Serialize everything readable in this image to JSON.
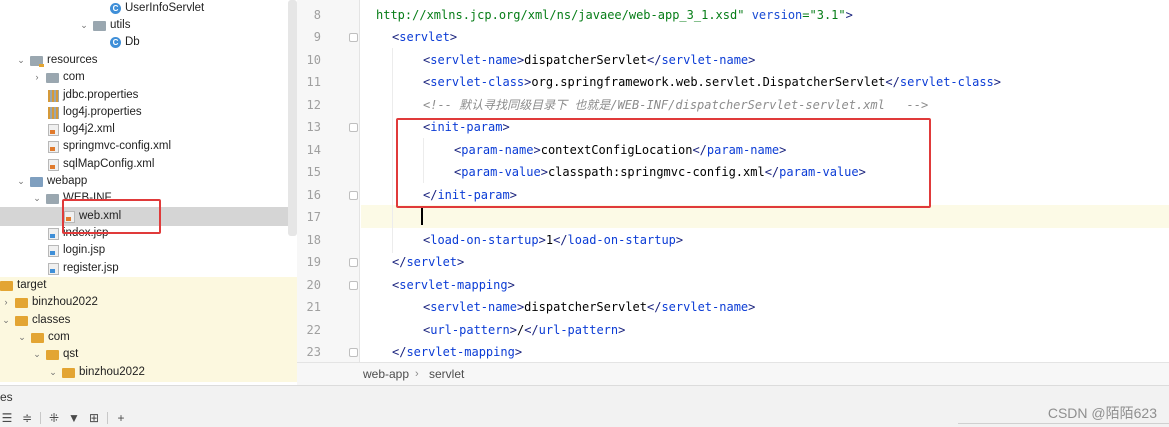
{
  "tree": {
    "items": [
      {
        "label": "UserInfoServlet",
        "icon": "class-icon"
      },
      {
        "label": "utils",
        "icon": "folder-icon"
      },
      {
        "label": "Db",
        "icon": "class-icon"
      },
      {
        "label": "resources",
        "icon": "resources-folder-icon"
      },
      {
        "label": "com",
        "icon": "folder-icon"
      },
      {
        "label": "jdbc.properties",
        "icon": "properties-file-icon"
      },
      {
        "label": "log4j.properties",
        "icon": "properties-file-icon"
      },
      {
        "label": "log4j2.xml",
        "icon": "xml-file-icon"
      },
      {
        "label": "springmvc-config.xml",
        "icon": "xml-file-icon"
      },
      {
        "label": "sqlMapConfig.xml",
        "icon": "xml-file-icon"
      },
      {
        "label": "webapp",
        "icon": "web-folder-icon"
      },
      {
        "label": "WEB-INF",
        "icon": "folder-icon"
      },
      {
        "label": "web.xml",
        "icon": "xml-file-icon"
      },
      {
        "label": "index.jsp",
        "icon": "jsp-file-icon"
      },
      {
        "label": "login.jsp",
        "icon": "jsp-file-icon"
      },
      {
        "label": "register.jsp",
        "icon": "jsp-file-icon"
      },
      {
        "label": "target",
        "icon": "excluded-folder-icon"
      },
      {
        "label": "binzhou2022",
        "icon": "excluded-folder-icon"
      },
      {
        "label": "classes",
        "icon": "excluded-folder-icon"
      },
      {
        "label": "com",
        "icon": "excluded-folder-icon"
      },
      {
        "label": "qst",
        "icon": "excluded-folder-icon"
      },
      {
        "label": "binzhou2022",
        "icon": "excluded-folder-icon"
      }
    ],
    "selected": "web.xml"
  },
  "editor": {
    "line_numbers": [
      "8",
      "9",
      "10",
      "11",
      "12",
      "13",
      "14",
      "15",
      "16",
      "17",
      "18",
      "19",
      "20",
      "21",
      "22",
      "23"
    ],
    "lines": [
      {
        "parts": [
          {
            "c": "t-str",
            "t": "http://xmlns.jcp.org/xml/ns/javaee/web-app_3_1.xsd\""
          },
          {
            "c": "t-attr",
            "t": " version"
          },
          {
            "c": "t-str",
            "t": "=\"3.1\""
          },
          {
            "c": "t-tag",
            "t": ">"
          }
        ]
      },
      {
        "parts": [
          {
            "c": "t-tag",
            "t": "<"
          },
          {
            "c": "t-name",
            "t": "servlet"
          },
          {
            "c": "t-tag",
            "t": ">"
          }
        ]
      },
      {
        "parts": [
          {
            "c": "t-tag",
            "t": "<"
          },
          {
            "c": "t-name",
            "t": "servlet-name"
          },
          {
            "c": "t-tag",
            "t": ">"
          },
          {
            "c": "t-txt",
            "t": "dispatcherServlet"
          },
          {
            "c": "t-tag",
            "t": "</"
          },
          {
            "c": "t-name",
            "t": "servlet-name"
          },
          {
            "c": "t-tag",
            "t": ">"
          }
        ]
      },
      {
        "parts": [
          {
            "c": "t-tag",
            "t": "<"
          },
          {
            "c": "t-name",
            "t": "servlet-class"
          },
          {
            "c": "t-tag",
            "t": ">"
          },
          {
            "c": "t-txt",
            "t": "org.springframework.web.servlet.DispatcherServlet"
          },
          {
            "c": "t-tag",
            "t": "</"
          },
          {
            "c": "t-name",
            "t": "servlet-class"
          },
          {
            "c": "t-tag",
            "t": ">"
          }
        ]
      },
      {
        "parts": [
          {
            "c": "t-cmt",
            "t": "<!-- 默认寻找同级目录下 也就是/WEB-INF/dispatcherServlet-servlet.xml   -->"
          }
        ]
      },
      {
        "parts": [
          {
            "c": "t-tag",
            "t": "<"
          },
          {
            "c": "t-name",
            "t": "init-param"
          },
          {
            "c": "t-tag",
            "t": ">"
          }
        ]
      },
      {
        "parts": [
          {
            "c": "t-tag",
            "t": "<"
          },
          {
            "c": "t-name",
            "t": "param-name"
          },
          {
            "c": "t-tag",
            "t": ">"
          },
          {
            "c": "t-txt",
            "t": "contextConfigLocation"
          },
          {
            "c": "t-tag",
            "t": "</"
          },
          {
            "c": "t-name",
            "t": "param-name"
          },
          {
            "c": "t-tag",
            "t": ">"
          }
        ]
      },
      {
        "parts": [
          {
            "c": "t-tag",
            "t": "<"
          },
          {
            "c": "t-name",
            "t": "param-value"
          },
          {
            "c": "t-tag",
            "t": ">"
          },
          {
            "c": "t-txt",
            "t": "classpath:springmvc-config.xml"
          },
          {
            "c": "t-tag",
            "t": "</"
          },
          {
            "c": "t-name",
            "t": "param-value"
          },
          {
            "c": "t-tag",
            "t": ">"
          }
        ]
      },
      {
        "parts": [
          {
            "c": "t-tag",
            "t": "</"
          },
          {
            "c": "t-name",
            "t": "init-param"
          },
          {
            "c": "t-tag",
            "t": ">"
          }
        ]
      },
      {
        "parts": []
      },
      {
        "parts": [
          {
            "c": "t-tag",
            "t": "<"
          },
          {
            "c": "t-name",
            "t": "load-on-startup"
          },
          {
            "c": "t-tag",
            "t": ">"
          },
          {
            "c": "t-txt",
            "t": "1"
          },
          {
            "c": "t-tag",
            "t": "</"
          },
          {
            "c": "t-name",
            "t": "load-on-startup"
          },
          {
            "c": "t-tag",
            "t": ">"
          }
        ]
      },
      {
        "parts": [
          {
            "c": "t-tag",
            "t": "</"
          },
          {
            "c": "t-name",
            "t": "servlet"
          },
          {
            "c": "t-tag",
            "t": ">"
          }
        ]
      },
      {
        "parts": [
          {
            "c": "t-tag",
            "t": "<"
          },
          {
            "c": "t-name",
            "t": "servlet-mapping"
          },
          {
            "c": "t-tag",
            "t": ">"
          }
        ]
      },
      {
        "parts": [
          {
            "c": "t-tag",
            "t": "<"
          },
          {
            "c": "t-name",
            "t": "servlet-name"
          },
          {
            "c": "t-tag",
            "t": ">"
          },
          {
            "c": "t-txt",
            "t": "dispatcherServlet"
          },
          {
            "c": "t-tag",
            "t": "</"
          },
          {
            "c": "t-name",
            "t": "servlet-name"
          },
          {
            "c": "t-tag",
            "t": ">"
          }
        ]
      },
      {
        "parts": [
          {
            "c": "t-tag",
            "t": "<"
          },
          {
            "c": "t-name",
            "t": "url-pattern"
          },
          {
            "c": "t-tag",
            "t": ">"
          },
          {
            "c": "t-txt",
            "t": "/"
          },
          {
            "c": "t-tag",
            "t": "</"
          },
          {
            "c": "t-name",
            "t": "url-pattern"
          },
          {
            "c": "t-tag",
            "t": ">"
          }
        ]
      },
      {
        "parts": [
          {
            "c": "t-tag",
            "t": "</"
          },
          {
            "c": "t-name",
            "t": "servlet-mapping"
          },
          {
            "c": "t-tag",
            "t": ">"
          }
        ]
      }
    ]
  },
  "breadcrumb": {
    "items": [
      "web-app",
      "servlet"
    ]
  },
  "bottom_panel": {
    "title": "es"
  },
  "watermark": "CSDN @陌陌623",
  "colors": {
    "annotation_red": "#e03a3a",
    "tag": "#0b3cd6",
    "string": "#067d17",
    "comment": "#8c8c8c"
  }
}
